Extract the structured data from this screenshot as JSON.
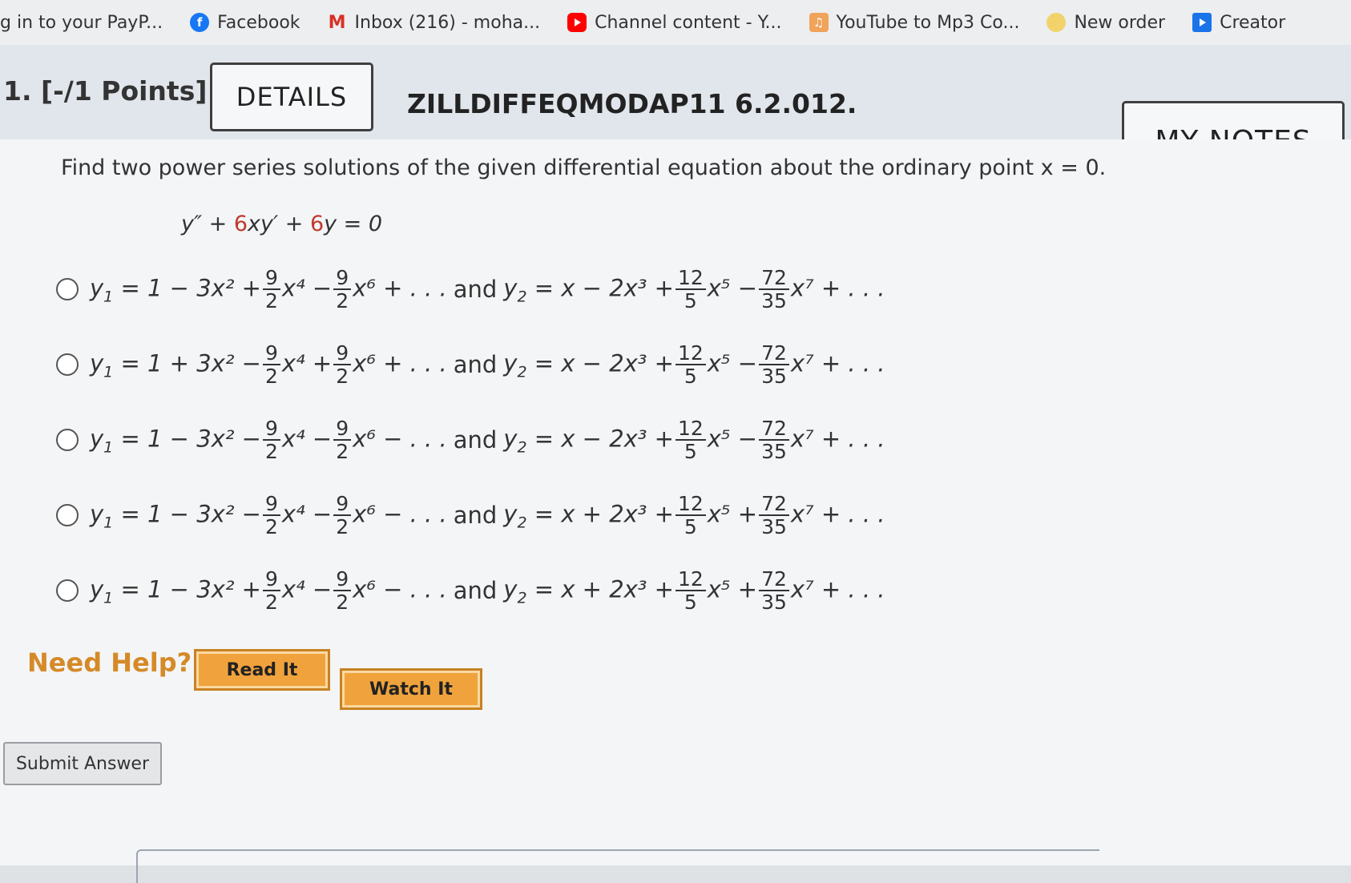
{
  "bookmarks": [
    {
      "label": "g in to your PayP...",
      "icon": "none"
    },
    {
      "label": "Facebook",
      "icon": "facebook-icon"
    },
    {
      "label": "Inbox (216) - moha...",
      "icon": "gmail-icon"
    },
    {
      "label": "Channel content - Y...",
      "icon": "youtube-icon"
    },
    {
      "label": "YouTube to Mp3 Co...",
      "icon": "converter-icon"
    },
    {
      "label": "New order",
      "icon": "order-icon"
    },
    {
      "label": "Creator",
      "icon": "creator-icon"
    }
  ],
  "question": {
    "number": "1. [-/1 Points]",
    "details_label": "DETAILS",
    "code": "ZILLDIFFEQMODAP11 6.2.012.",
    "notes_label": "MY NOTES",
    "prompt": "Find two power series solutions of the given differential equation about the ordinary point x = 0.",
    "equation": {
      "lhs": "y″ + ",
      "c1": "6",
      "mid": "xy′ + ",
      "c2": "6",
      "rhs": "y = 0"
    },
    "options": [
      {
        "y1": [
          "1 − 3x² +",
          "9",
          "2",
          "x⁴ −",
          "9",
          "2",
          "x⁶ + . . ."
        ],
        "y2": [
          "x − 2x³ +",
          "12",
          "5",
          "x⁵ −",
          "72",
          "35",
          "x⁷ + . . ."
        ]
      },
      {
        "y1": [
          "1 + 3x² −",
          "9",
          "2",
          "x⁴ +",
          "9",
          "2",
          "x⁶ + . . ."
        ],
        "y2": [
          "x − 2x³ +",
          "12",
          "5",
          "x⁵ −",
          "72",
          "35",
          "x⁷ + . . ."
        ]
      },
      {
        "y1": [
          "1 − 3x² −",
          "9",
          "2",
          "x⁴ −",
          "9",
          "2",
          "x⁶ − . . ."
        ],
        "y2": [
          "x − 2x³ +",
          "12",
          "5",
          "x⁵ −",
          "72",
          "35",
          "x⁷ + . . ."
        ]
      },
      {
        "y1": [
          "1 − 3x² −",
          "9",
          "2",
          "x⁴ −",
          "9",
          "2",
          "x⁶ − . . ."
        ],
        "y2": [
          "x + 2x³ +",
          "12",
          "5",
          "x⁵ +",
          "72",
          "35",
          "x⁷ + . . ."
        ]
      },
      {
        "y1": [
          "1 − 3x² +",
          "9",
          "2",
          "x⁴ −",
          "9",
          "2",
          "x⁶ − . . ."
        ],
        "y2": [
          "x + 2x³ +",
          "12",
          "5",
          "x⁵ +",
          "72",
          "35",
          "x⁷ + . . ."
        ]
      }
    ],
    "y1_label": "y",
    "y1_sub": "1",
    "y2_label": "y",
    "y2_sub": "2",
    "equals": " = ",
    "and": "and"
  },
  "help": {
    "label": "Need Help?",
    "read_label": "Read It",
    "watch_label": "Watch It"
  },
  "submit_label": "Submit Answer",
  "colors": {
    "coefficient_red": "#c0392b",
    "help_orange": "#f0a33c"
  }
}
